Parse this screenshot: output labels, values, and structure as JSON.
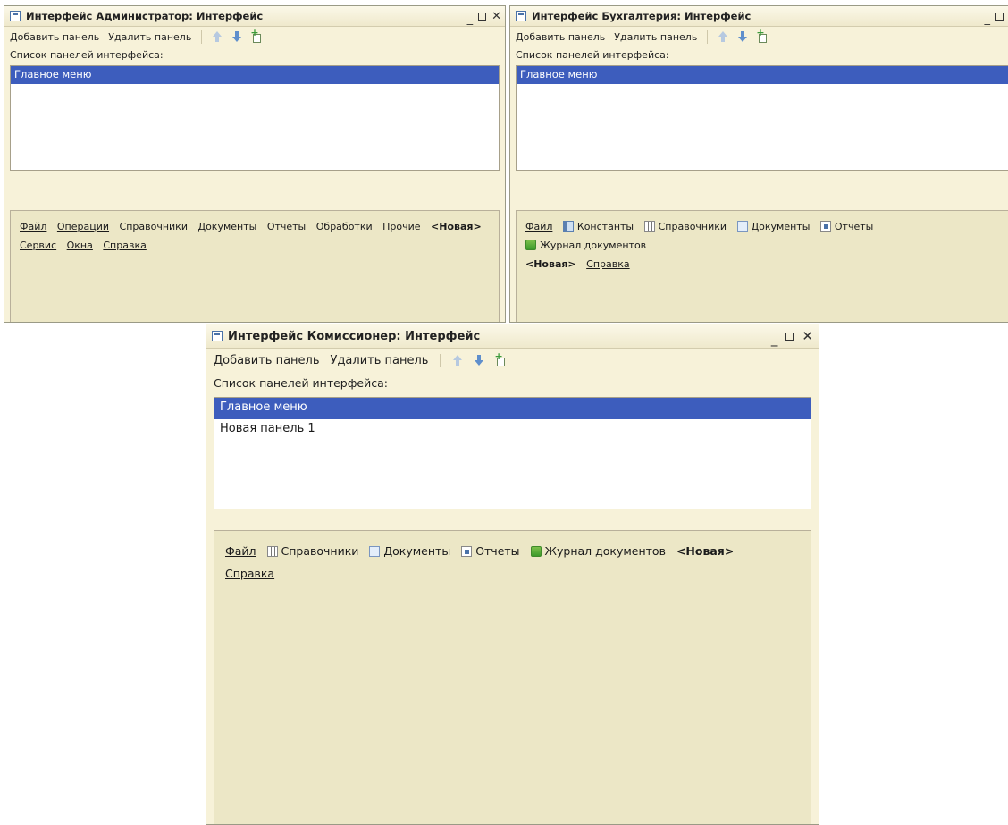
{
  "windows": [
    {
      "title": "Интерфейс Администратор: Интерфейс",
      "toolbar": {
        "add_label": "Добавить панель",
        "remove_label": "Удалить панель"
      },
      "list_label": "Список панелей интерфейса:",
      "list_items": [
        "Главное меню"
      ],
      "menu_items": [
        "Файл",
        "Операции",
        "Справочники",
        "Документы",
        "Отчеты",
        "Обработки",
        "Прочие",
        "<Новая>",
        "Сервис",
        "Окна",
        "Справка"
      ]
    },
    {
      "title": "Интерфейс Бухгалтерия: Интерфейс",
      "toolbar": {
        "add_label": "Добавить панель",
        "remove_label": "Удалить панель"
      },
      "list_label": "Список панелей интерфейса:",
      "list_items": [
        "Главное меню"
      ],
      "menu_items": [
        "Файл",
        "Константы",
        "Справочники",
        "Документы",
        "Отчеты",
        "Журнал документов",
        "<Новая>",
        "Справка"
      ]
    },
    {
      "title": "Интерфейс Комиссионер: Интерфейс",
      "toolbar": {
        "add_label": "Добавить панель",
        "remove_label": "Удалить панель"
      },
      "list_label": "Список панелей интерфейса:",
      "list_items": [
        "Главное меню",
        "Новая панель 1"
      ],
      "menu_items": [
        "Файл",
        "Справочники",
        "Документы",
        "Отчеты",
        "Журнал документов",
        "<Новая>",
        "Справка"
      ]
    }
  ],
  "window_controls": {
    "minimize": "_",
    "close": "✕"
  },
  "colors": {
    "window_bg": "#f7f2d9",
    "selection": "#3d5dbd",
    "preview_bg": "#ece7c6"
  }
}
